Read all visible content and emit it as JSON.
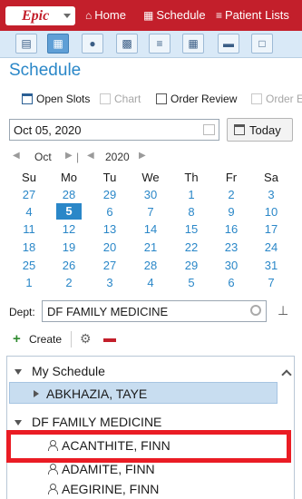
{
  "topbar": {
    "logo": "Epic",
    "home_label": "Home",
    "schedule_label": "Schedule",
    "patient_lists_label": "Patient Lists"
  },
  "page_title": "Schedule",
  "toolbar_actions": {
    "open_slots": "Open Slots",
    "chart": "Chart",
    "order_review": "Order Review",
    "order_entry": "Order E"
  },
  "date_field": {
    "value": "Oct 05, 2020"
  },
  "today_label": "Today",
  "month_nav": {
    "month": "Oct",
    "year": "2020"
  },
  "calendar": {
    "weekdays": [
      "Su",
      "Mo",
      "Tu",
      "We",
      "Th",
      "Fr",
      "Sa"
    ],
    "selected_day": "5",
    "weeks": [
      [
        "27",
        "28",
        "29",
        "30",
        "1",
        "2",
        "3"
      ],
      [
        "4",
        "5",
        "6",
        "7",
        "8",
        "9",
        "10"
      ],
      [
        "11",
        "12",
        "13",
        "14",
        "15",
        "16",
        "17"
      ],
      [
        "18",
        "19",
        "20",
        "21",
        "22",
        "23",
        "24"
      ],
      [
        "25",
        "26",
        "27",
        "28",
        "29",
        "30",
        "31"
      ],
      [
        "1",
        "2",
        "3",
        "4",
        "5",
        "6",
        "7"
      ]
    ]
  },
  "dept": {
    "label": "Dept:",
    "value": "DF FAMILY MEDICINE"
  },
  "create_label": "Create",
  "tree": {
    "my_schedule": "My Schedule",
    "my_schedule_child": "ABKHAZIA, TAYE",
    "dept_group": "DF FAMILY MEDICINE",
    "providers": [
      "ACANTHITE, FINN",
      "ADAMITE, FINN",
      "AEGIRINE, FINN"
    ]
  },
  "colors": {
    "brand_red": "#c31f2b",
    "accent_blue": "#2a87c8",
    "highlight_red": "#ea1c24"
  }
}
